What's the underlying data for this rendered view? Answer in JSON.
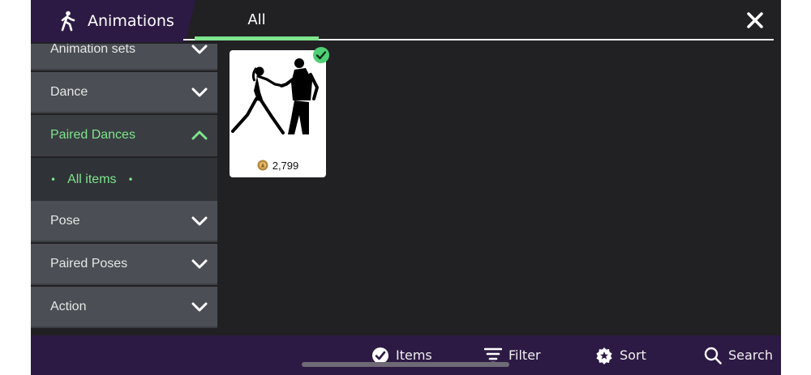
{
  "header": {
    "title": "Animations",
    "tabs": [
      {
        "label": "All",
        "active": true
      }
    ]
  },
  "sidebar": {
    "items": [
      {
        "label": "Animation sets",
        "expanded": false
      },
      {
        "label": "Dance",
        "expanded": false
      },
      {
        "label": "Paired Dances",
        "expanded": true,
        "subitems": [
          {
            "label": "All items",
            "selected": true
          }
        ]
      },
      {
        "label": "Pose",
        "expanded": false
      },
      {
        "label": "Paired Poses",
        "expanded": false
      },
      {
        "label": "Action",
        "expanded": false
      }
    ]
  },
  "items": [
    {
      "price": "2,799",
      "owned": true,
      "image": "dancing-couple-silhouette"
    }
  ],
  "bottom_bar": {
    "items_label": "Items",
    "filter_label": "Filter",
    "sort_label": "Sort",
    "search_label": "Search"
  },
  "colors": {
    "accent": "#7ee58d",
    "brand_purple": "#2d1a44",
    "background": "#212023",
    "category_bg": "#4b4f55"
  }
}
